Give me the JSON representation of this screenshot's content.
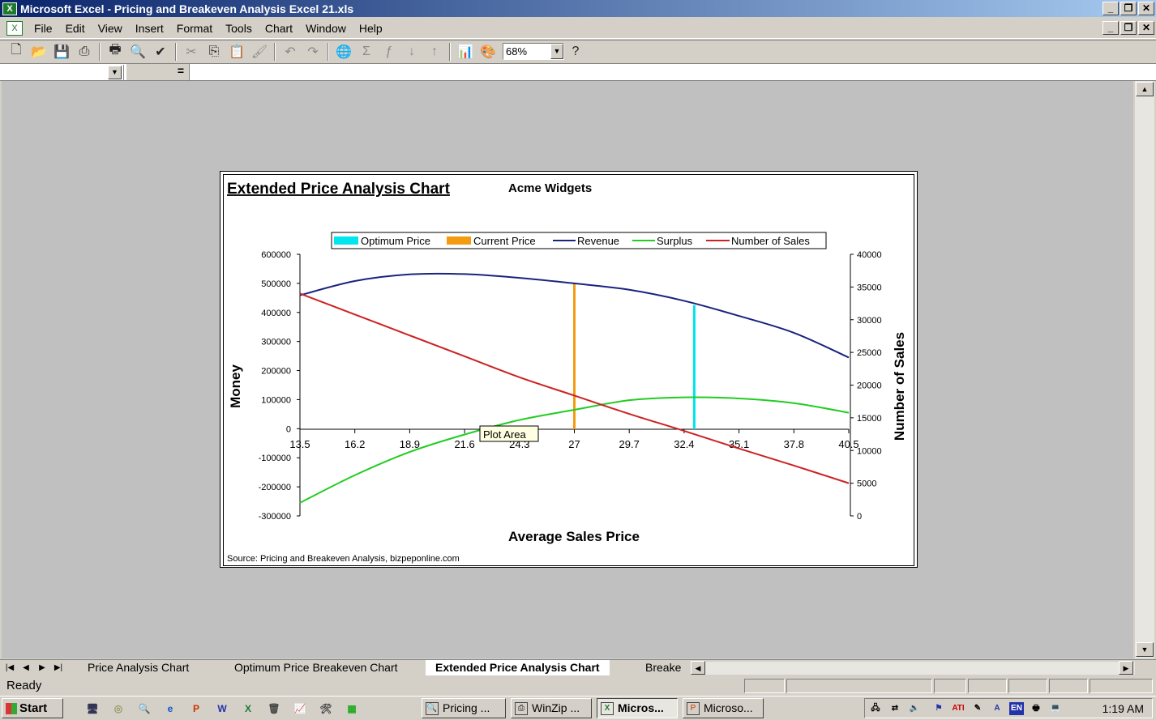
{
  "window": {
    "title": "Microsoft Excel - Pricing and Breakeven Analysis Excel 21.xls"
  },
  "menu": [
    "File",
    "Edit",
    "View",
    "Insert",
    "Format",
    "Tools",
    "Chart",
    "Window",
    "Help"
  ],
  "toolbar": {
    "zoom": "68%",
    "icons": [
      "new-icon",
      "open-icon",
      "save-icon",
      "print-setup-icon",
      "print-icon",
      "print-preview-icon",
      "spelling-icon",
      "cut-icon",
      "copy-icon",
      "paste-icon",
      "format-painter-icon",
      "undo-icon",
      "redo-icon",
      "hyperlink-icon",
      "autosum-icon",
      "function-icon",
      "sort-ascending-icon",
      "sort-descending-icon",
      "chart-wizard-icon",
      "drawing-icon",
      "help-icon"
    ]
  },
  "formula_bar": {
    "equals": "="
  },
  "chart": {
    "title": "Extended Price Analysis Chart",
    "company": "Acme Widgets",
    "tooltip": "Plot Area",
    "source": "Source: Pricing and Breakeven Analysis, bizpeponline.com",
    "colors": {
      "optimum": "#00e5ee",
      "current": "#f39c12",
      "revenue": "#1a237e",
      "surplus": "#22cc22",
      "sales": "#cc2222"
    }
  },
  "chart_data": {
    "type": "line",
    "title": "Extended Price Analysis Chart",
    "subtitle": "Acme Widgets",
    "xlabel": "Average Sales Price",
    "ylabel": "Money",
    "y2label": "Number of Sales",
    "x_ticks": [
      "13.5",
      "16.2",
      "18.9",
      "21.6",
      "24.3",
      "27",
      "29.7",
      "32.4",
      "35.1",
      "37.8",
      "40.5"
    ],
    "xlim": [
      13.5,
      40.5
    ],
    "ylim": [
      -300000,
      600000
    ],
    "y_ticks": [
      "600000",
      "500000",
      "400000",
      "300000",
      "200000",
      "100000",
      "0",
      "-100000",
      "-200000",
      "-300000"
    ],
    "y2lim": [
      0,
      40000
    ],
    "y2_ticks": [
      "40000",
      "35000",
      "30000",
      "25000",
      "20000",
      "15000",
      "10000",
      "5000",
      "0"
    ],
    "legend_position": "top",
    "legend": [
      "Optimum Price",
      "Current Price",
      "Revenue",
      "Surplus",
      "Number of Sales"
    ],
    "grid": false,
    "optimum_price": 32.9,
    "current_price": 27,
    "series": [
      {
        "name": "Revenue",
        "axis": "left",
        "x": [
          13.5,
          16.2,
          18.9,
          21.6,
          24.3,
          27,
          29.7,
          32.4,
          35.1,
          37.8,
          40.5
        ],
        "values": [
          459000,
          508000,
          531000,
          532000,
          519000,
          500000,
          478000,
          440000,
          388000,
          330000,
          245000
        ]
      },
      {
        "name": "Surplus",
        "axis": "left",
        "x": [
          13.5,
          16.2,
          18.9,
          21.6,
          24.3,
          27,
          29.7,
          32.4,
          35.1,
          37.8,
          40.5
        ],
        "values": [
          -255000,
          -160000,
          -80000,
          -20000,
          30000,
          65000,
          98000,
          108000,
          104000,
          88000,
          55000
        ]
      },
      {
        "name": "Number of Sales",
        "axis": "right",
        "x": [
          13.5,
          16.2,
          18.9,
          21.6,
          24.3,
          27,
          29.7,
          32.4,
          35.1,
          37.8,
          40.5
        ],
        "values": [
          34000,
          30800,
          27600,
          24400,
          21200,
          18400,
          15600,
          13000,
          10300,
          7700,
          5000
        ]
      }
    ]
  },
  "sheet_tabs": [
    "Price Analysis Chart",
    "Optimum Price Breakeven Chart",
    "Extended Price Analysis Chart",
    "Breake"
  ],
  "active_tab": "Extended Price Analysis Chart",
  "status": "Ready",
  "taskbar": {
    "start": "Start",
    "tasks": [
      "Pricing ...",
      "WinZip ...",
      "Micros...",
      "Microso..."
    ],
    "active_task": "Micros...",
    "clock": "1:19 AM",
    "tray_lang": "EN"
  }
}
